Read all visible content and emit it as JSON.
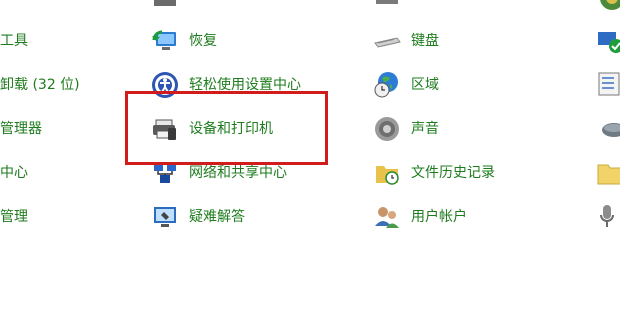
{
  "control_panel": {
    "col1": {
      "row0": "工具",
      "row1": "卸载 (32 位)",
      "row2": "管理器",
      "row3": "中心",
      "row4": "管理"
    },
    "col2": {
      "row0": "恢复",
      "row1": "轻松使用设置中心",
      "row2": "设备和打印机",
      "row3": "网络和共享中心",
      "row4": "疑难解答"
    },
    "col3": {
      "row0": "键盘",
      "row1": "区域",
      "row2": "声音",
      "row3": "文件历史记录",
      "row4": "用户帐户"
    }
  },
  "highlight": {
    "color": "#d21c1c",
    "target": "设备和打印机"
  },
  "colors": {
    "link_text": "#1e7c1e",
    "background": "#ffffff"
  }
}
